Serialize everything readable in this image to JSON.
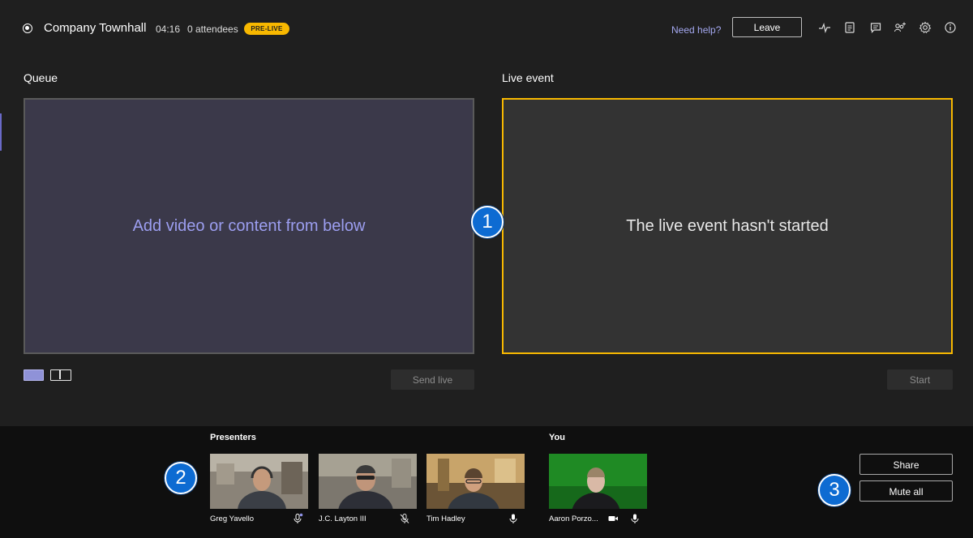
{
  "header": {
    "title": "Company Townhall",
    "timer": "04:16",
    "attendees": "0 attendees",
    "badge": "PRE-LIVE",
    "help_link": "Need help?",
    "leave_label": "Leave",
    "icons": [
      "health-monitor-icon",
      "notes-icon",
      "chat-icon",
      "add-people-icon",
      "gear-icon",
      "info-icon"
    ]
  },
  "queue": {
    "label": "Queue",
    "placeholder": "Add video or content from below",
    "send_live_label": "Send live"
  },
  "live": {
    "label": "Live event",
    "status": "The live event hasn't started",
    "start_label": "Start"
  },
  "presenters": {
    "label": "Presenters",
    "items": [
      {
        "name": "Greg Yavello",
        "mic": "mic-active-icon"
      },
      {
        "name": "J.C. Layton III",
        "mic": "mic-muted-icon"
      },
      {
        "name": "Tim Hadley",
        "mic": "mic-icon"
      }
    ]
  },
  "you": {
    "label": "You",
    "name": "Aaron Porzo...",
    "icons": [
      "camera-icon",
      "mic-icon"
    ]
  },
  "actions": {
    "share_label": "Share",
    "mute_all_label": "Mute all"
  },
  "callouts": [
    "1",
    "2",
    "3"
  ],
  "colors": {
    "accent_yellow": "#f8b800",
    "accent_purple": "#9c9ef0",
    "callout_blue": "#0d6bd2",
    "background": "#1f1f1f"
  }
}
